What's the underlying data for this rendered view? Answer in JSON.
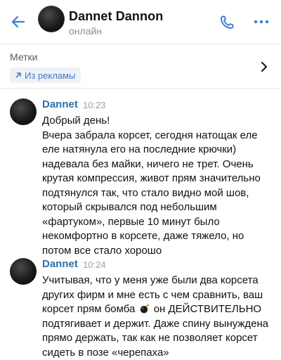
{
  "header": {
    "title": "Dannet Dannon",
    "status": "онлайн"
  },
  "labels": {
    "title": "Метки",
    "chip": "Из рекламы"
  },
  "messages": [
    {
      "author": "Dannet",
      "time": "10:23",
      "lines": [
        "Добрый день!",
        "Вчера забрала корсет, сегодня натощак еле",
        "еле натянула его на последние крючки)",
        "надевала без майки, ничего не трет. Очень",
        "крутая компрессия, живот прям значительно",
        "подтянулся так, что стало видно мой шов,",
        "который скрывался под небольшим",
        "«фартуком», первые 10 минут было",
        "некомфортно в корсете, даже тяжело, но",
        "потом все стало хорошо"
      ]
    },
    {
      "author": "Dannet",
      "time": "10:24",
      "lines": [
        "Учитывая, что у меня уже были два корсета",
        "других фирм и мне есть с чем сравнить, ваш",
        "корсет прям бомба",
        "он ДЕЙСТВИТЕЛЬНО",
        "подтягивает и держит. Даже спину вынуждена",
        "прямо держать, так как не позволяет корсет",
        "сидеть в позе «черепаха»"
      ],
      "emoji": "bomb"
    }
  ],
  "colors": {
    "accent": "#2f6ea8",
    "chip_text": "#3f79c4",
    "chip_bg": "#eef2f7",
    "muted": "#8a8f96"
  },
  "icons": [
    "back-arrow-icon",
    "phone-icon",
    "more-icon",
    "external-arrow-icon",
    "chevron-right-icon",
    "bomb-emoji-icon"
  ]
}
